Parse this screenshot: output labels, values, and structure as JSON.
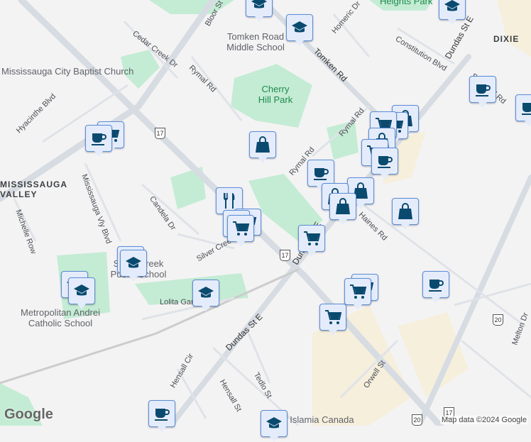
{
  "roads": [
    "Bloor St",
    "Cedar Creek Dr",
    "Rymal Rd",
    "Tomken Rd",
    "Homeric Dr",
    "Constitution Blvd",
    "Dundas St E",
    "Hyacinthe Blvd",
    "Mississauga Vly Blvd",
    "Michelle Row",
    "Candela Dr",
    "Silver Creek",
    "Lolita Gardens",
    "Hensall Cir",
    "Tedlo St",
    "Hensall St",
    "Orwell St",
    "Haines Rd",
    "Stanfield Rd",
    "Melton Dr",
    "Rymal Rd",
    "Dundas St E",
    "St"
  ],
  "pois": {
    "church": "Mississauga City Baptist Church",
    "school1": "Tomken Road Middle School",
    "park1": "Cherry Hill Park",
    "park2": "Heights Park",
    "school2": "Silver Creek Public School",
    "school3": "Metropolitan Andrei Catholic School",
    "mosque": "Jamia Islamia Canada"
  },
  "areas": [
    "DIXIE",
    "MISSISSAUGA VALLEY"
  ],
  "highway_shields": [
    "17",
    "17",
    "17",
    "20",
    "20",
    "17"
  ],
  "marker_types": [
    "school",
    "coffee",
    "shopping-cart",
    "shopping-bag",
    "restaurant"
  ],
  "attribution": "Map data ©2024 Google",
  "logo": "Google",
  "colors": {
    "park": "#c4ecd4",
    "commercial": "#f6efdc",
    "road": "#d6dce2",
    "marker": "#0b4a6f"
  }
}
